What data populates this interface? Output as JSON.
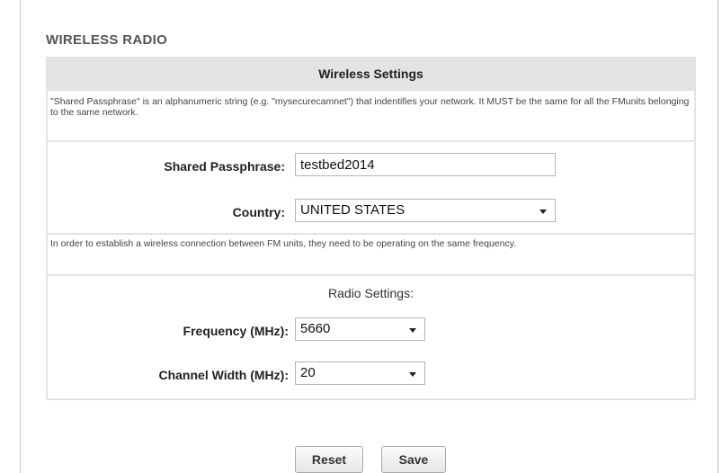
{
  "section_title": "WIRELESS RADIO",
  "panel_title": "Wireless Settings",
  "passphrase_note": "\"Shared Passphrase\" is an alphanumeric string (e.g. \"mysecurecamnet\") that indentifies your network. It MUST be the same for all the FMunits belonging to the same network.",
  "fields": {
    "passphrase_label": "Shared Passphrase:",
    "passphrase_value": "testbed2014",
    "country_label": "Country:",
    "country_value": "UNITED STATES"
  },
  "frequency_note": "In order to establish a wireless connection between FM units, they need to be operating on the same frequency.",
  "radio": {
    "heading": "Radio Settings:",
    "frequency_label": "Frequency (MHz):",
    "frequency_value": "5660",
    "channel_width_label": "Channel Width (MHz):",
    "channel_width_value": "20"
  },
  "buttons": {
    "reset": "Reset",
    "save": "Save"
  }
}
